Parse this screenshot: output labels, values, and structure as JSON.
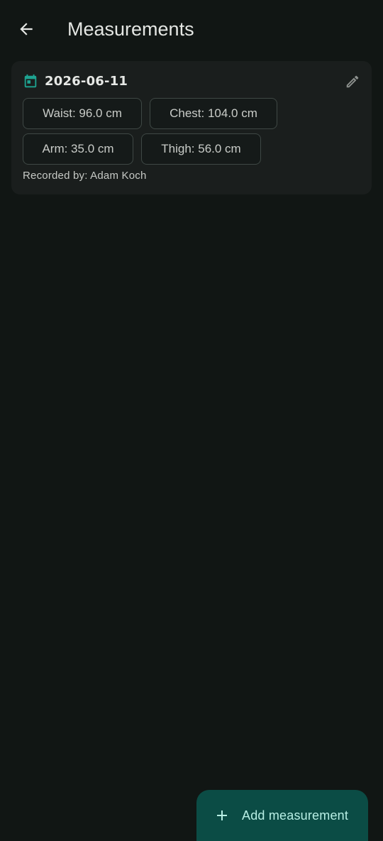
{
  "app_bar": {
    "title": "Measurements",
    "back_icon": "arrow-back-icon"
  },
  "measurement_card": {
    "date": "2026-06-11",
    "date_icon": "calendar-icon",
    "edit_icon": "pencil-icon",
    "chips": {
      "waist": "Waist: 96.0 cm",
      "chest": "Chest: 104.0 cm",
      "arm": "Arm: 35.0 cm",
      "thigh": "Thigh: 56.0 cm"
    },
    "recorded_by": "Recorded by: Adam Koch"
  },
  "fab": {
    "label": "Add measurement",
    "icon": "plus-icon"
  },
  "colors": {
    "background": "#111614",
    "card": "#1a1e1d",
    "accent": "#1ea391",
    "fab_background": "#0b4c45",
    "fab_text": "#b8efe5"
  }
}
